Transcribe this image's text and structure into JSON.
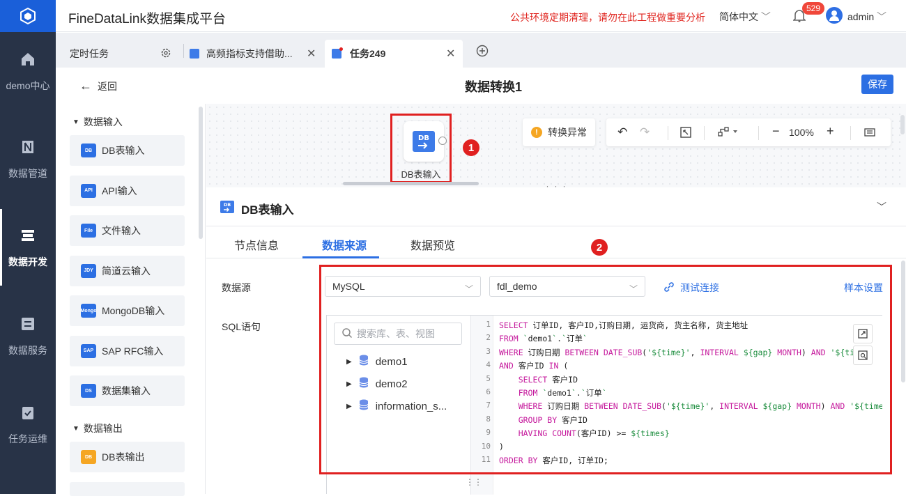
{
  "app": {
    "title": "FineDataLink数据集成平台",
    "notice": "公共环境定期清理，请勿在此工程做重要分析",
    "language": "简体中文",
    "notification_count": "529",
    "user": "admin"
  },
  "sidebar": {
    "items": [
      {
        "label": "demo中心",
        "icon": "home-icon"
      },
      {
        "label": "数据管道",
        "icon": "pipeline-icon"
      },
      {
        "label": "数据开发",
        "icon": "dev-icon",
        "active": true
      },
      {
        "label": "数据服务",
        "icon": "service-icon"
      },
      {
        "label": "任务运维",
        "icon": "ops-icon"
      }
    ]
  },
  "tabs": [
    {
      "label": "定时任务"
    },
    {
      "label": "高频指标支持借助..."
    },
    {
      "label": "任务249",
      "active": true
    }
  ],
  "header": {
    "back_label": "返回",
    "title": "数据转换1",
    "save_label": "保存"
  },
  "palette": {
    "input_section": "数据输入",
    "output_section": "数据输出",
    "inputs": [
      {
        "label": "DB表输入",
        "icon_text": "DB",
        "color": "#2c6fe3"
      },
      {
        "label": "API输入",
        "icon_text": "API",
        "color": "#2c6fe3"
      },
      {
        "label": "文件输入",
        "icon_text": "File",
        "color": "#2c6fe3"
      },
      {
        "label": "简道云输入",
        "icon_text": "JDY",
        "color": "#2c6fe3"
      },
      {
        "label": "MongoDB输入",
        "icon_text": "Mongo",
        "color": "#2c6fe3"
      },
      {
        "label": "SAP RFC输入",
        "icon_text": "SAP",
        "color": "#2c6fe3"
      },
      {
        "label": "数据集输入",
        "icon_text": "DS",
        "color": "#2c6fe3"
      }
    ],
    "outputs": [
      {
        "label": "DB表输出",
        "icon_text": "DB",
        "color": "#f5a623"
      }
    ]
  },
  "canvas": {
    "node_label": "DB表输入",
    "marker1": "1",
    "marker2": "2",
    "error_label": "转换异常",
    "zoom": "100%"
  },
  "panel": {
    "title": "DB表输入",
    "tabs": [
      "节点信息",
      "数据来源",
      "数据预览"
    ],
    "active_tab": 1,
    "datasource_label": "数据源",
    "db_type": "MySQL",
    "connection": "fdl_demo",
    "test_link": "测试连接",
    "sample_link": "样本设置",
    "sql_label": "SQL语句",
    "search_placeholder": "搜索库、表、视图",
    "tree": [
      "demo1",
      "demo2",
      "information_s..."
    ],
    "line_numbers": [
      "1",
      "2",
      "3",
      "4",
      "5",
      "6",
      "7",
      "8",
      "9",
      "10",
      "11"
    ],
    "sql_lines": [
      "SELECT 订单ID, 客户ID,订购日期, 运货商, 货主名称, 货主地址",
      "FROM `demo1`.`订单`",
      "WHERE 订购日期 BETWEEN DATE_SUB('${time}', INTERVAL ${gap} MONTH) AND '${ti",
      "AND 客户ID IN (",
      "    SELECT 客户ID",
      "    FROM `demo1`.`订单`",
      "    WHERE 订购日期 BETWEEN DATE_SUB('${time}', INTERVAL ${gap} MONTH) AND '${time",
      "    GROUP BY 客户ID",
      "    HAVING COUNT(客户ID) >= ${times}",
      ")",
      "ORDER BY 客户ID, 订单ID;"
    ]
  }
}
